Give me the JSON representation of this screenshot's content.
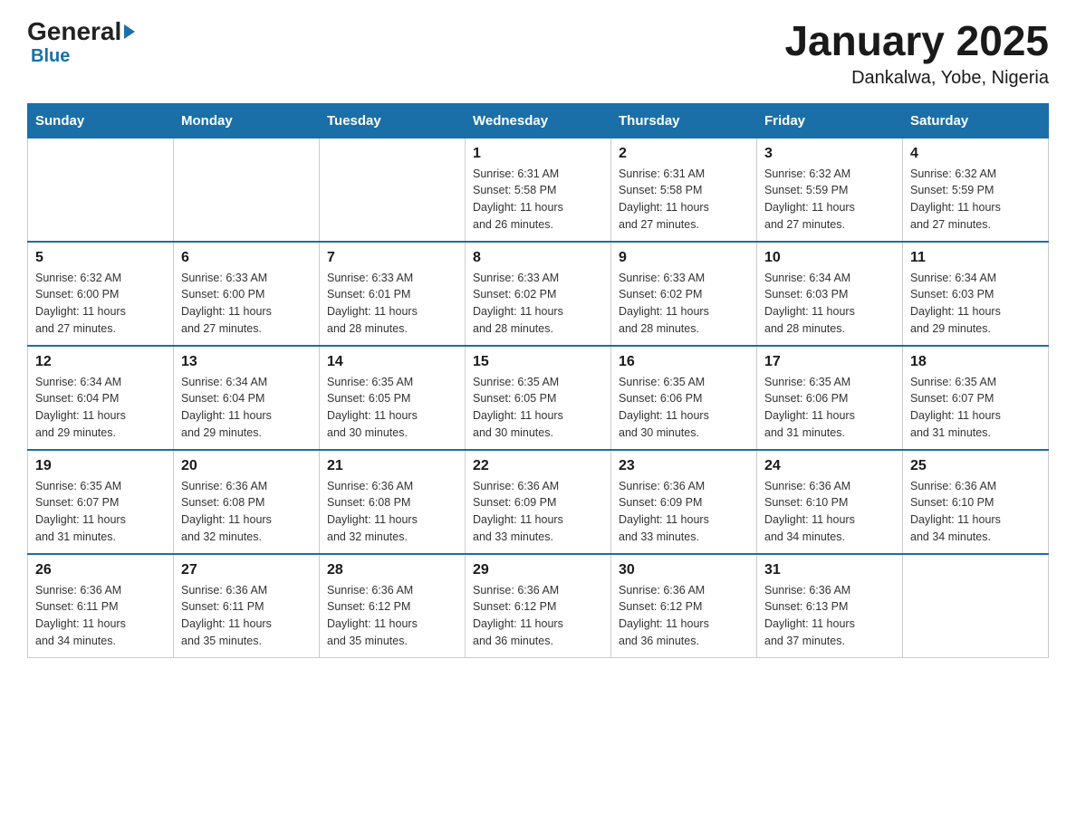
{
  "header": {
    "logo_general": "General",
    "logo_blue": "Blue",
    "title": "January 2025",
    "subtitle": "Dankalwa, Yobe, Nigeria"
  },
  "days_of_week": [
    "Sunday",
    "Monday",
    "Tuesday",
    "Wednesday",
    "Thursday",
    "Friday",
    "Saturday"
  ],
  "weeks": [
    [
      {
        "day": "",
        "info": ""
      },
      {
        "day": "",
        "info": ""
      },
      {
        "day": "",
        "info": ""
      },
      {
        "day": "1",
        "info": "Sunrise: 6:31 AM\nSunset: 5:58 PM\nDaylight: 11 hours\nand 26 minutes."
      },
      {
        "day": "2",
        "info": "Sunrise: 6:31 AM\nSunset: 5:58 PM\nDaylight: 11 hours\nand 27 minutes."
      },
      {
        "day": "3",
        "info": "Sunrise: 6:32 AM\nSunset: 5:59 PM\nDaylight: 11 hours\nand 27 minutes."
      },
      {
        "day": "4",
        "info": "Sunrise: 6:32 AM\nSunset: 5:59 PM\nDaylight: 11 hours\nand 27 minutes."
      }
    ],
    [
      {
        "day": "5",
        "info": "Sunrise: 6:32 AM\nSunset: 6:00 PM\nDaylight: 11 hours\nand 27 minutes."
      },
      {
        "day": "6",
        "info": "Sunrise: 6:33 AM\nSunset: 6:00 PM\nDaylight: 11 hours\nand 27 minutes."
      },
      {
        "day": "7",
        "info": "Sunrise: 6:33 AM\nSunset: 6:01 PM\nDaylight: 11 hours\nand 28 minutes."
      },
      {
        "day": "8",
        "info": "Sunrise: 6:33 AM\nSunset: 6:02 PM\nDaylight: 11 hours\nand 28 minutes."
      },
      {
        "day": "9",
        "info": "Sunrise: 6:33 AM\nSunset: 6:02 PM\nDaylight: 11 hours\nand 28 minutes."
      },
      {
        "day": "10",
        "info": "Sunrise: 6:34 AM\nSunset: 6:03 PM\nDaylight: 11 hours\nand 28 minutes."
      },
      {
        "day": "11",
        "info": "Sunrise: 6:34 AM\nSunset: 6:03 PM\nDaylight: 11 hours\nand 29 minutes."
      }
    ],
    [
      {
        "day": "12",
        "info": "Sunrise: 6:34 AM\nSunset: 6:04 PM\nDaylight: 11 hours\nand 29 minutes."
      },
      {
        "day": "13",
        "info": "Sunrise: 6:34 AM\nSunset: 6:04 PM\nDaylight: 11 hours\nand 29 minutes."
      },
      {
        "day": "14",
        "info": "Sunrise: 6:35 AM\nSunset: 6:05 PM\nDaylight: 11 hours\nand 30 minutes."
      },
      {
        "day": "15",
        "info": "Sunrise: 6:35 AM\nSunset: 6:05 PM\nDaylight: 11 hours\nand 30 minutes."
      },
      {
        "day": "16",
        "info": "Sunrise: 6:35 AM\nSunset: 6:06 PM\nDaylight: 11 hours\nand 30 minutes."
      },
      {
        "day": "17",
        "info": "Sunrise: 6:35 AM\nSunset: 6:06 PM\nDaylight: 11 hours\nand 31 minutes."
      },
      {
        "day": "18",
        "info": "Sunrise: 6:35 AM\nSunset: 6:07 PM\nDaylight: 11 hours\nand 31 minutes."
      }
    ],
    [
      {
        "day": "19",
        "info": "Sunrise: 6:35 AM\nSunset: 6:07 PM\nDaylight: 11 hours\nand 31 minutes."
      },
      {
        "day": "20",
        "info": "Sunrise: 6:36 AM\nSunset: 6:08 PM\nDaylight: 11 hours\nand 32 minutes."
      },
      {
        "day": "21",
        "info": "Sunrise: 6:36 AM\nSunset: 6:08 PM\nDaylight: 11 hours\nand 32 minutes."
      },
      {
        "day": "22",
        "info": "Sunrise: 6:36 AM\nSunset: 6:09 PM\nDaylight: 11 hours\nand 33 minutes."
      },
      {
        "day": "23",
        "info": "Sunrise: 6:36 AM\nSunset: 6:09 PM\nDaylight: 11 hours\nand 33 minutes."
      },
      {
        "day": "24",
        "info": "Sunrise: 6:36 AM\nSunset: 6:10 PM\nDaylight: 11 hours\nand 34 minutes."
      },
      {
        "day": "25",
        "info": "Sunrise: 6:36 AM\nSunset: 6:10 PM\nDaylight: 11 hours\nand 34 minutes."
      }
    ],
    [
      {
        "day": "26",
        "info": "Sunrise: 6:36 AM\nSunset: 6:11 PM\nDaylight: 11 hours\nand 34 minutes."
      },
      {
        "day": "27",
        "info": "Sunrise: 6:36 AM\nSunset: 6:11 PM\nDaylight: 11 hours\nand 35 minutes."
      },
      {
        "day": "28",
        "info": "Sunrise: 6:36 AM\nSunset: 6:12 PM\nDaylight: 11 hours\nand 35 minutes."
      },
      {
        "day": "29",
        "info": "Sunrise: 6:36 AM\nSunset: 6:12 PM\nDaylight: 11 hours\nand 36 minutes."
      },
      {
        "day": "30",
        "info": "Sunrise: 6:36 AM\nSunset: 6:12 PM\nDaylight: 11 hours\nand 36 minutes."
      },
      {
        "day": "31",
        "info": "Sunrise: 6:36 AM\nSunset: 6:13 PM\nDaylight: 11 hours\nand 37 minutes."
      },
      {
        "day": "",
        "info": ""
      }
    ]
  ]
}
